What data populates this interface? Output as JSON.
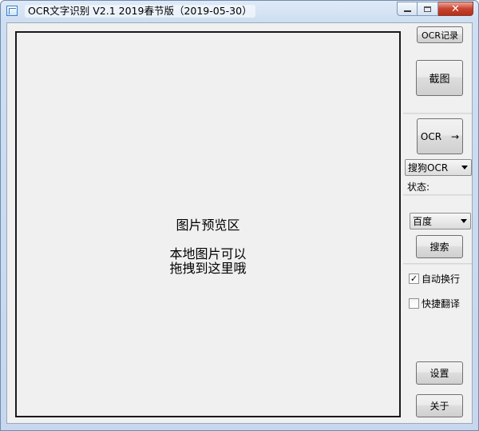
{
  "window": {
    "title": "OCR文字识别 V2.1   2019春节版（2019-05-30）",
    "close_label": "✕"
  },
  "preview": {
    "title": "图片预览区",
    "hint": "本地图片可以\n拖拽到这里哦"
  },
  "sidebar": {
    "ocr_log_label": "OCR记录",
    "capture_label": "截图",
    "ocr_label": "OCR",
    "ocr_arrow": "→",
    "engine_selected": "搜狗OCR",
    "status_label": "状态:",
    "search_engine_selected": "百度",
    "search_label": "搜索",
    "auto_wrap_label": "自动换行",
    "auto_wrap_checked": true,
    "auto_wrap_mark": "✓",
    "fast_translate_label": "快捷翻译",
    "fast_translate_checked": false,
    "settings_label": "设置",
    "about_label": "关于"
  }
}
